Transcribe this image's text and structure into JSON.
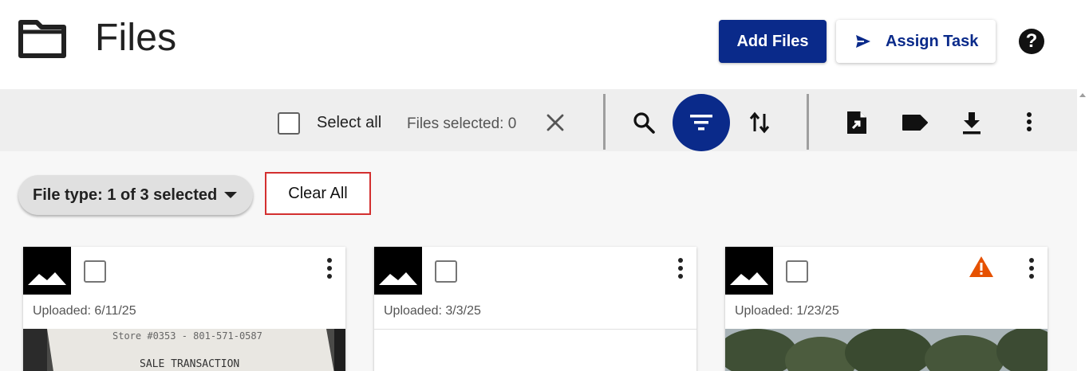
{
  "header": {
    "title": "Files",
    "add_files_label": "Add Files",
    "assign_task_label": "Assign Task",
    "help_glyph": "?"
  },
  "toolbar": {
    "select_all_label": "Select all",
    "files_selected_text": "Files selected: 0",
    "icons": [
      "close-icon",
      "search-icon",
      "filter-icon",
      "sort-icon",
      "file-export-icon",
      "tag-icon",
      "download-icon",
      "more-vert-icon"
    ]
  },
  "filters": {
    "file_type_chip": "File type: 1 of 3 selected",
    "clear_all_label": "Clear All"
  },
  "cards": [
    {
      "uploaded": "Uploaded: 6/11/25",
      "warning": false,
      "preview": "receipt",
      "receipt_line1": "Store #0353 - 801-571-0587",
      "receipt_line2": "SALE TRANSACTION"
    },
    {
      "uploaded": "Uploaded: 3/3/25",
      "warning": false,
      "preview": "blank"
    },
    {
      "uploaded": "Uploaded: 1/23/25",
      "warning": true,
      "preview": "trees"
    }
  ],
  "colors": {
    "primary": "#0a2a8a",
    "toolbar_bg": "#eeeeee",
    "warning": "#e65100",
    "clear_all_border": "#d32f2f"
  }
}
